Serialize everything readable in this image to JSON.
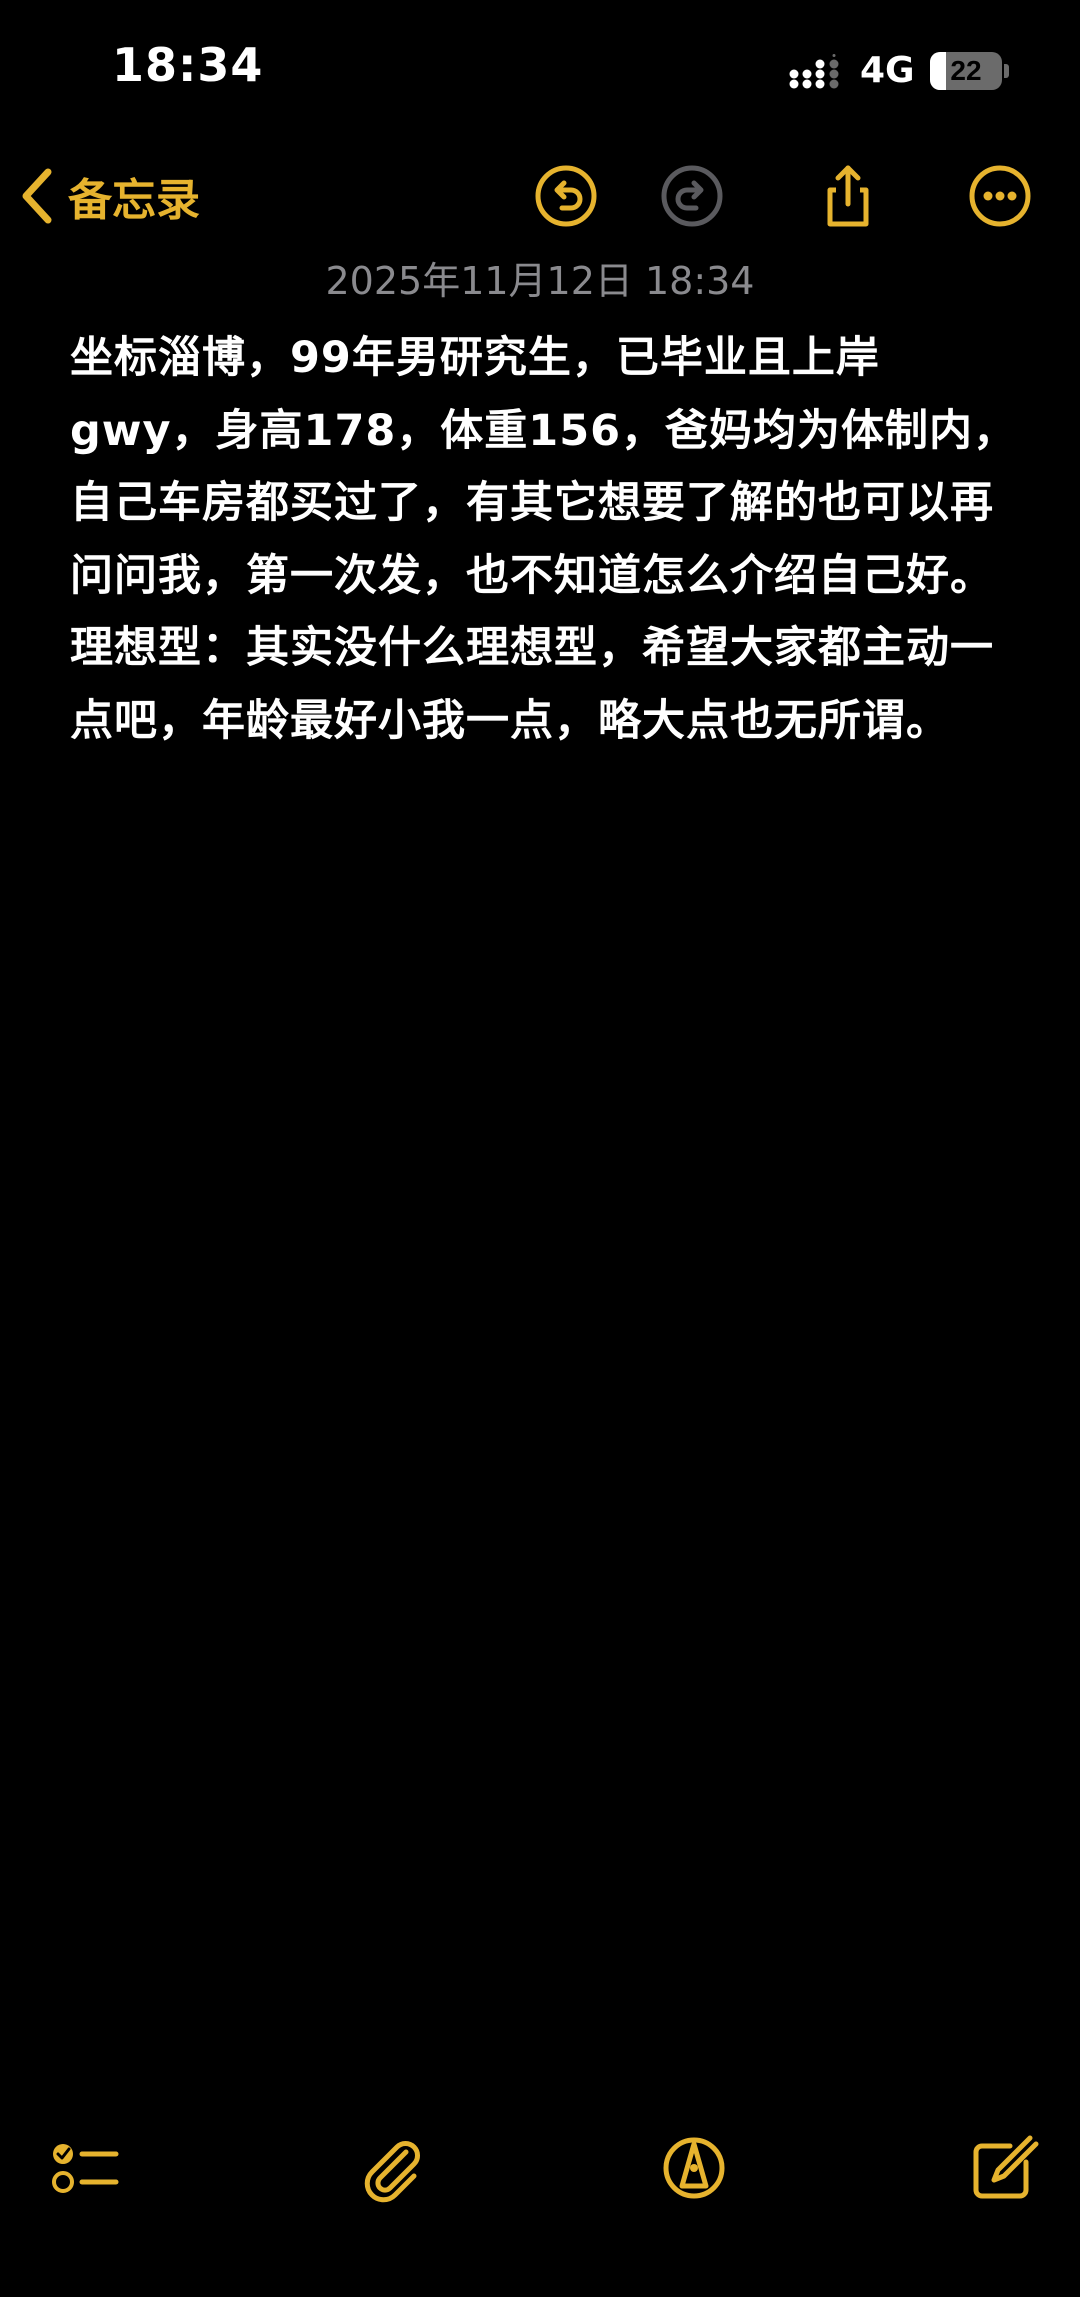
{
  "status_bar": {
    "time": "18:34",
    "network": "4G",
    "battery_level": "22",
    "battery_fraction": 0.22,
    "signal_icon": "cellular-signal-icon"
  },
  "nav": {
    "back_label": "备忘录",
    "icons": {
      "back": "chevron-left-icon",
      "undo": "undo-icon",
      "redo": "redo-icon",
      "share": "share-icon",
      "more": "more-options-icon"
    },
    "redo_enabled": false
  },
  "note": {
    "date": "2025年11月12日 18:34",
    "paragraphs": [
      "坐标淄博，99年男研究生，已毕业且上岸 gwy，身高178，体重156，爸妈均为体制内，自己车房都买过了，有其它想要了解的也可以再问问我，第一次发，也不知道怎么介绍自己好。",
      "理想型：其实没什么理想型，希望大家都主动一点吧，年龄最好小我一点，略大点也无所谓。"
    ]
  },
  "toolbar": {
    "icons": {
      "checklist": "checklist-icon",
      "attachment": "paperclip-icon",
      "markup": "markup-pen-icon",
      "compose": "compose-icon"
    }
  },
  "colors": {
    "background": "#000000",
    "accent": "#e6b32e",
    "text": "#ffffff",
    "secondary_text": "#8a8a8e",
    "disabled_icon": "#5a5a5e"
  }
}
